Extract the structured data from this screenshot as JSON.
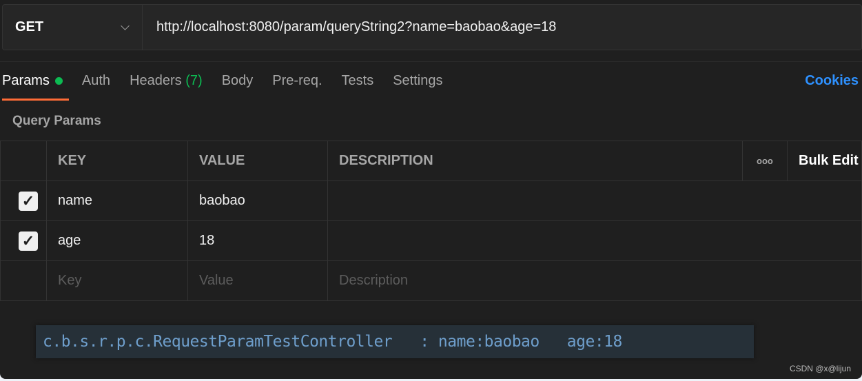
{
  "request": {
    "method": "GET",
    "url": "http://localhost:8080/param/queryString2?name=baobao&age=18"
  },
  "tabs": [
    {
      "label": "Params"
    },
    {
      "label": "Auth"
    },
    {
      "label": "Headers",
      "count": "(7)"
    },
    {
      "label": "Body"
    },
    {
      "label": "Pre-req."
    },
    {
      "label": "Tests"
    },
    {
      "label": "Settings"
    }
  ],
  "cookies": "Cookies",
  "section_title": "Query Params",
  "table": {
    "headers": [
      "KEY",
      "VALUE",
      "DESCRIPTION"
    ],
    "more": "ooo",
    "bulk_edit": "Bulk Edit",
    "rows": [
      {
        "checked": true,
        "key": "name",
        "value": "baobao",
        "description": ""
      },
      {
        "checked": true,
        "key": "age",
        "value": "18",
        "description": ""
      }
    ],
    "placeholders": {
      "key": "Key",
      "value": "Value",
      "description": "Description"
    }
  },
  "log": "c.b.s.r.p.c.RequestParamTestController   : name:baobao   age:18",
  "watermark": "CSDN @x@lijun"
}
